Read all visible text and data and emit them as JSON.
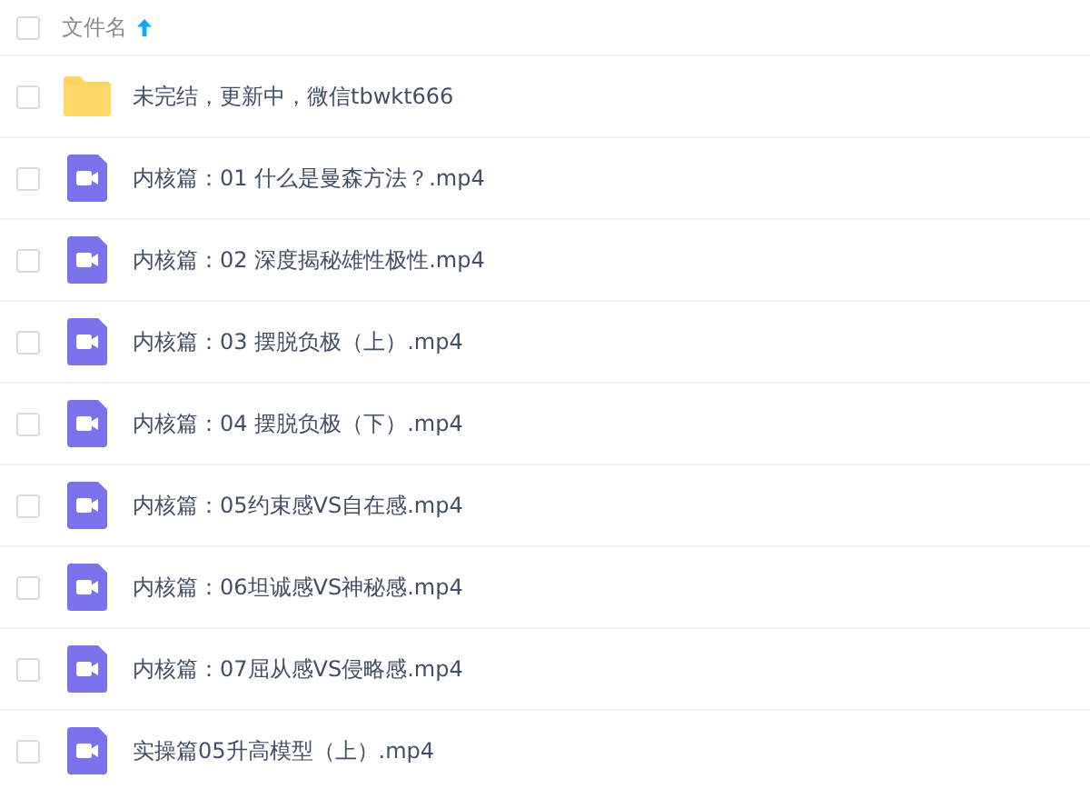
{
  "header": {
    "label": "文件名",
    "sort_ascending": true,
    "checked": false
  },
  "files": [
    {
      "kind": "folder",
      "name": "未完结，更新中，微信tbwkt666",
      "checked": false
    },
    {
      "kind": "video",
      "name": "内核篇：01 什么是曼森方法？.mp4",
      "checked": false
    },
    {
      "kind": "video",
      "name": "内核篇：02 深度揭秘雄性极性.mp4",
      "checked": false
    },
    {
      "kind": "video",
      "name": "内核篇：03 摆脱负极（上）.mp4",
      "checked": false
    },
    {
      "kind": "video",
      "name": "内核篇：04 摆脱负极（下）.mp4",
      "checked": false
    },
    {
      "kind": "video",
      "name": "内核篇：05约束感VS自在感.mp4",
      "checked": false
    },
    {
      "kind": "video",
      "name": "内核篇：06坦诚感VS神秘感.mp4",
      "checked": false
    },
    {
      "kind": "video",
      "name": "内核篇：07屈从感VS侵略感.mp4",
      "checked": false
    },
    {
      "kind": "video",
      "name": "实操篇05升高模型（上）.mp4",
      "checked": false
    }
  ]
}
